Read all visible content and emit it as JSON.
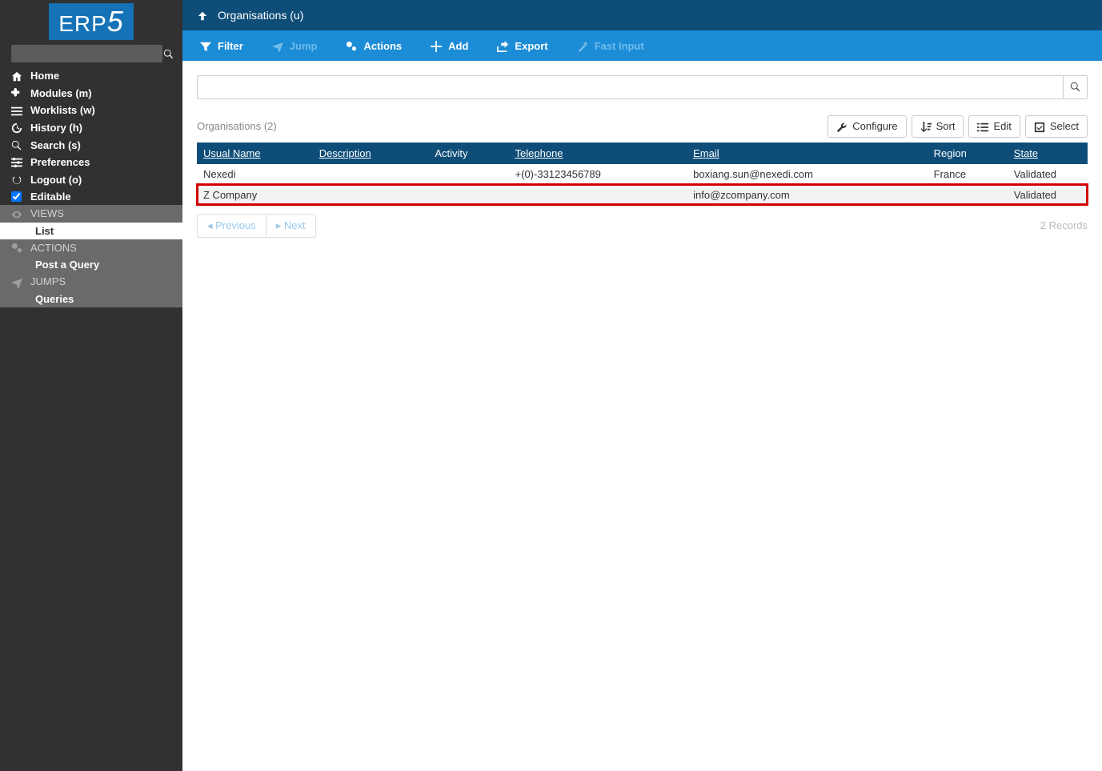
{
  "logo": {
    "text": "ERP",
    "suffix": "5"
  },
  "sidebar": {
    "search_placeholder": "",
    "nav": [
      {
        "icon": "home",
        "label": "Home"
      },
      {
        "icon": "puzzle",
        "label": "Modules (m)"
      },
      {
        "icon": "list",
        "label": "Worklists (w)"
      },
      {
        "icon": "history",
        "label": "History (h)"
      },
      {
        "icon": "search",
        "label": "Search (s)"
      },
      {
        "icon": "sliders",
        "label": "Preferences"
      },
      {
        "icon": "power",
        "label": "Logout (o)"
      }
    ],
    "editable_label": "Editable",
    "views": {
      "header": "VIEWS",
      "items": [
        "List"
      ]
    },
    "actions": {
      "header": "ACTIONS",
      "items": [
        "Post a Query"
      ]
    },
    "jumps": {
      "header": "JUMPS",
      "items": [
        "Queries"
      ]
    }
  },
  "topbar": {
    "breadcrumb": "Organisations (u)"
  },
  "toolbar": {
    "filter": "Filter",
    "jump": "Jump",
    "actions": "Actions",
    "add": "Add",
    "export": "Export",
    "fast_input": "Fast Input"
  },
  "list": {
    "title": "Organisations (2)",
    "buttons": {
      "configure": "Configure",
      "sort": "Sort",
      "edit": "Edit",
      "select": "Select"
    },
    "columns": {
      "usual_name": "Usual Name",
      "description": "Description",
      "activity": "Activity",
      "telephone": "Telephone",
      "email": "Email",
      "region": "Region",
      "state": "State"
    },
    "rows": [
      {
        "usual_name": "Nexedi",
        "description": "",
        "activity": "",
        "telephone": "+(0)-33123456789",
        "email": "boxiang.sun@nexedi.com",
        "region": "France",
        "state": "Validated"
      },
      {
        "usual_name": "Z Company",
        "description": "",
        "activity": "",
        "telephone": "",
        "email": "info@zcompany.com",
        "region": "",
        "state": "Validated"
      }
    ],
    "highlighted_row_index": 1,
    "pager": {
      "prev": "Previous",
      "next": "Next"
    },
    "records": "2 Records"
  }
}
